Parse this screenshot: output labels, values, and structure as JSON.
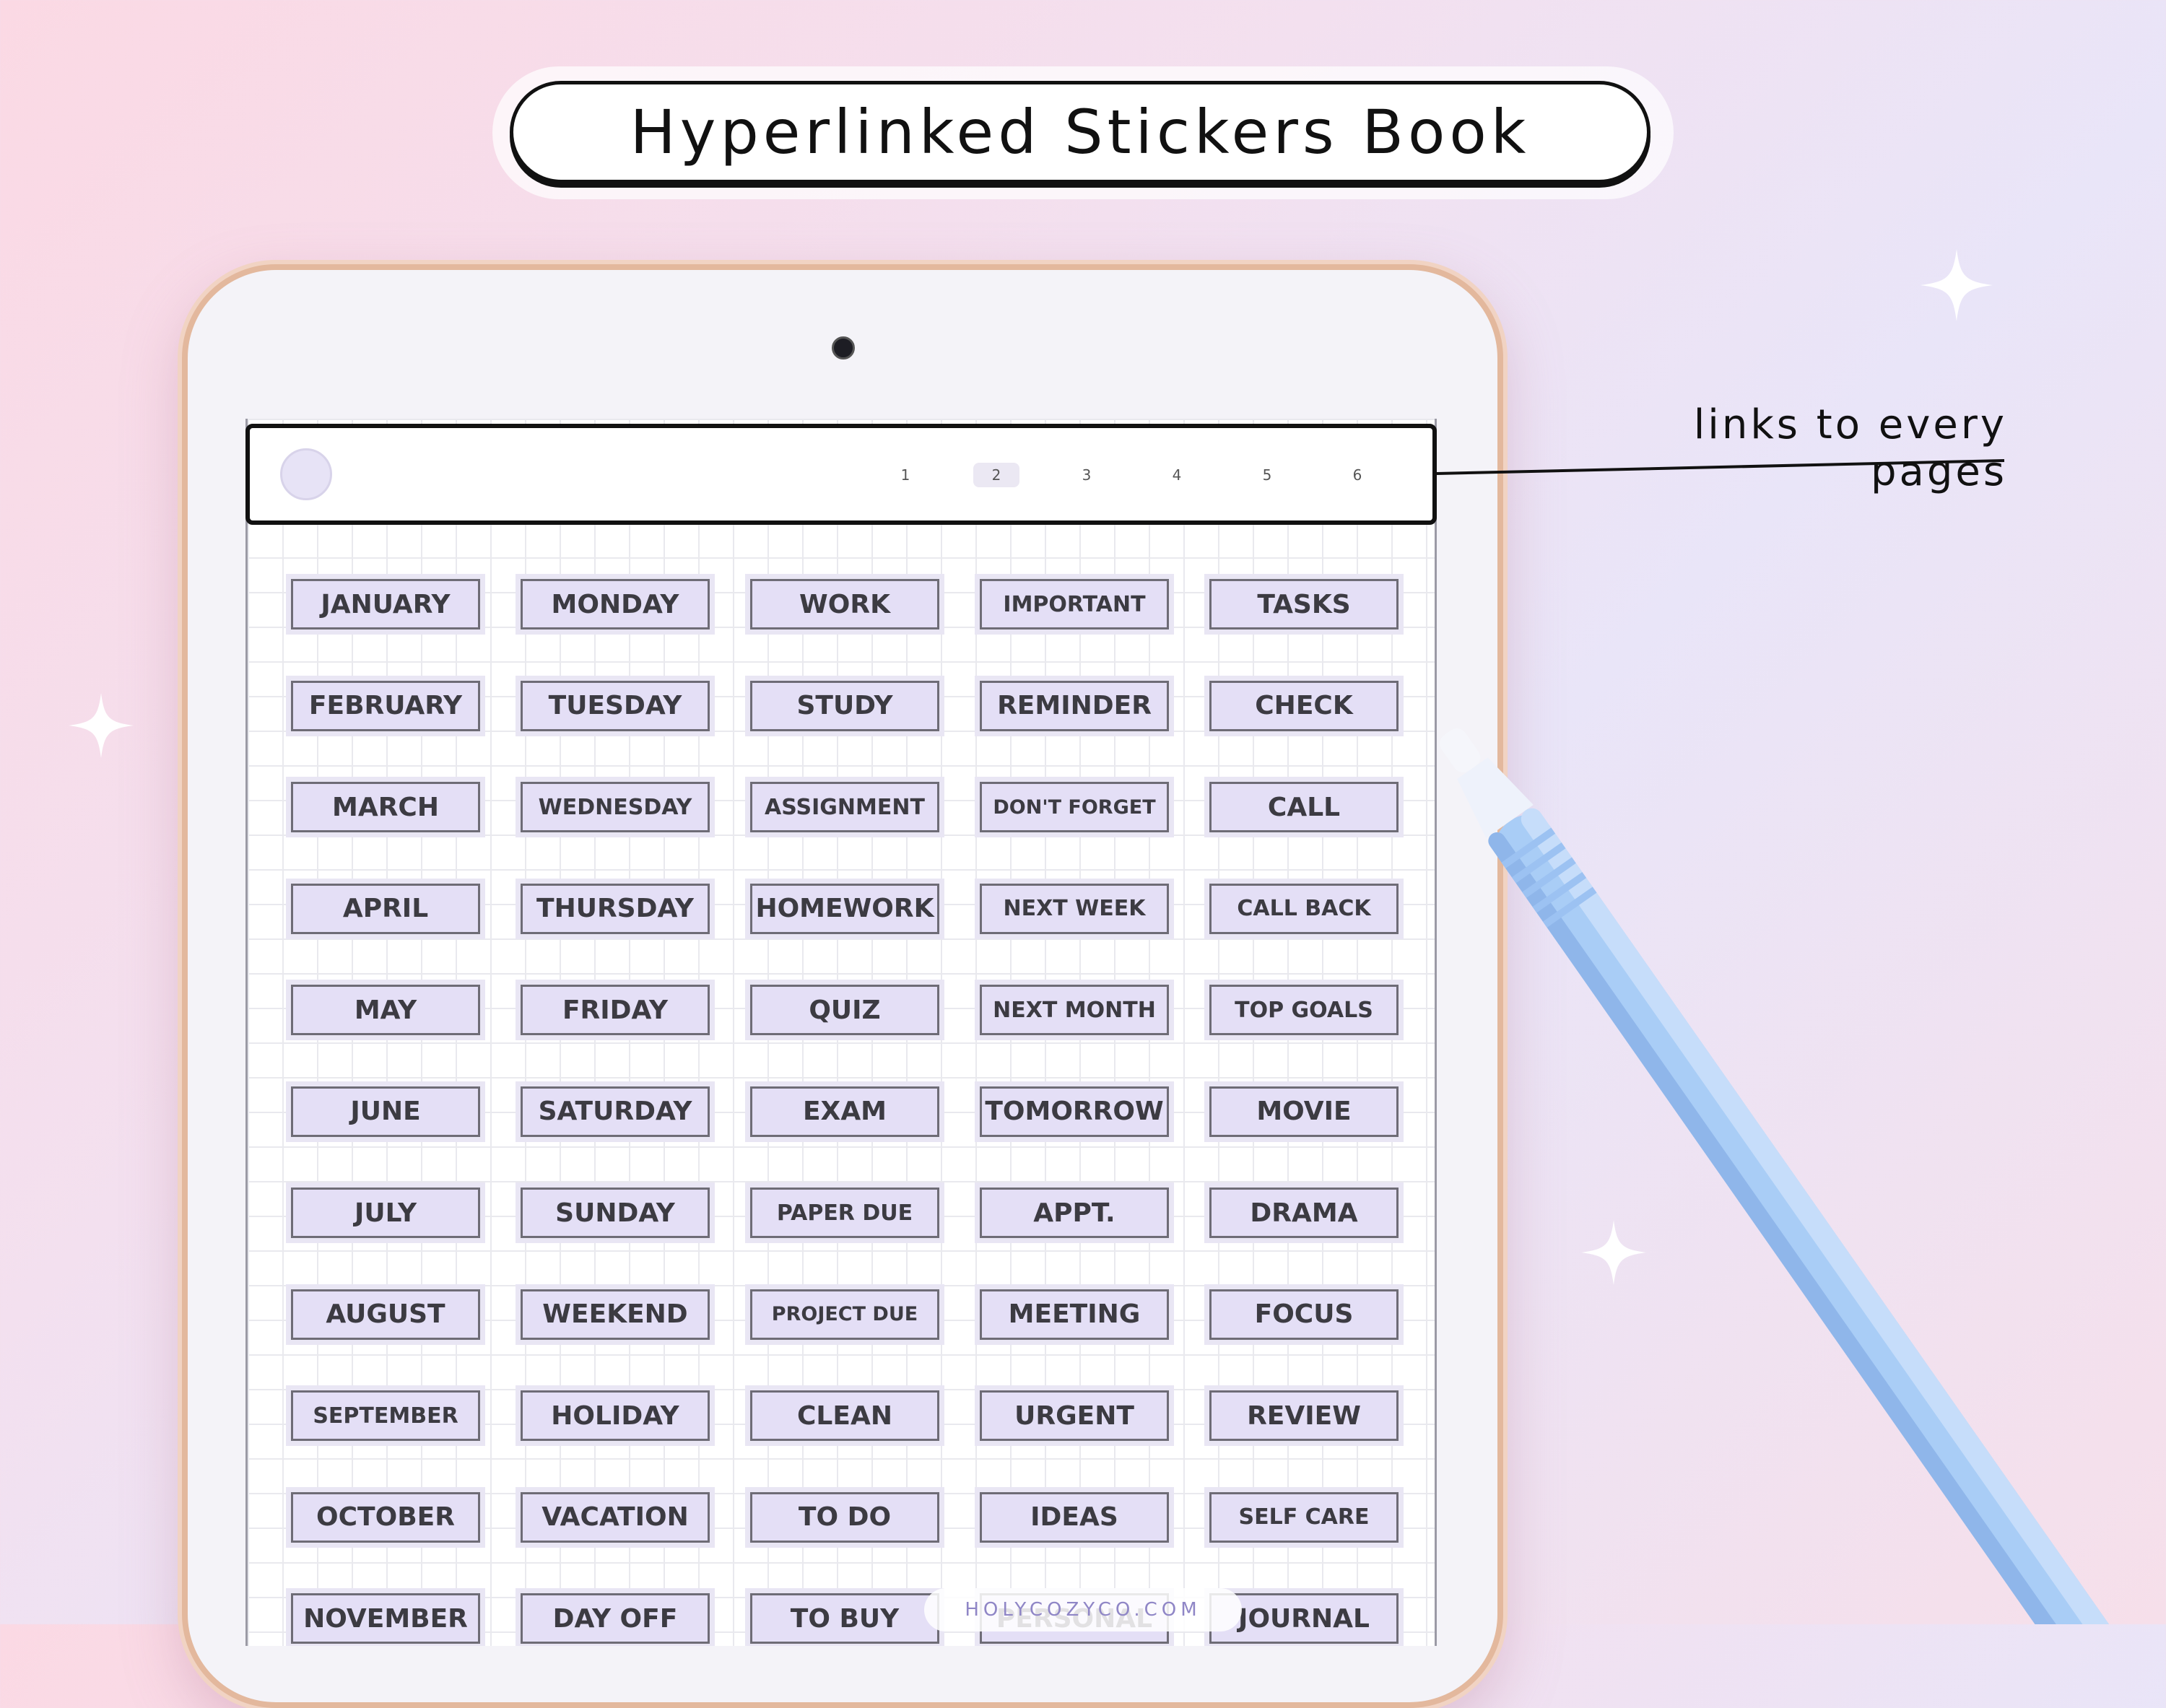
{
  "header": {
    "title": "Hyperlinked Stickers Book"
  },
  "callout": {
    "text": "links to every pages"
  },
  "tablet": {
    "page_tabs": [
      {
        "label": "1",
        "active": false
      },
      {
        "label": "2",
        "active": true
      },
      {
        "label": "3",
        "active": false
      },
      {
        "label": "4",
        "active": false
      },
      {
        "label": "5",
        "active": false
      },
      {
        "label": "6",
        "active": false
      }
    ],
    "stickers": [
      [
        "JANUARY",
        "MONDAY",
        "WORK",
        "IMPORTANT",
        "TASKS"
      ],
      [
        "FEBRUARY",
        "TUESDAY",
        "STUDY",
        "REMINDER",
        "CHECK"
      ],
      [
        "MARCH",
        "WEDNESDAY",
        "ASSIGNMENT",
        "DON'T FORGET",
        "CALL"
      ],
      [
        "APRIL",
        "THURSDAY",
        "HOMEWORK",
        "NEXT WEEK",
        "CALL BACK"
      ],
      [
        "MAY",
        "FRIDAY",
        "QUIZ",
        "NEXT MONTH",
        "TOP GOALS"
      ],
      [
        "JUNE",
        "SATURDAY",
        "EXAM",
        "TOMORROW",
        "MOVIE"
      ],
      [
        "JULY",
        "SUNDAY",
        "PAPER DUE",
        "APPT.",
        "DRAMA"
      ],
      [
        "AUGUST",
        "WEEKEND",
        "PROJECT DUE",
        "MEETING",
        "FOCUS"
      ],
      [
        "SEPTEMBER",
        "HOLIDAY",
        "CLEAN",
        "URGENT",
        "REVIEW"
      ],
      [
        "OCTOBER",
        "VACATION",
        "TO DO",
        "IDEAS",
        "SELF CARE"
      ],
      [
        "NOVEMBER",
        "DAY OFF",
        "TO BUY",
        "PERSONAL",
        "JOURNAL"
      ]
    ]
  },
  "watermark": {
    "text": "HOLYCOZYCO.COM"
  },
  "colors": {
    "sticker_fill": "#e4dff6",
    "sticker_text": "#3c3b42",
    "pencil": "#a9cdf6",
    "frame": "#e3b89d"
  }
}
